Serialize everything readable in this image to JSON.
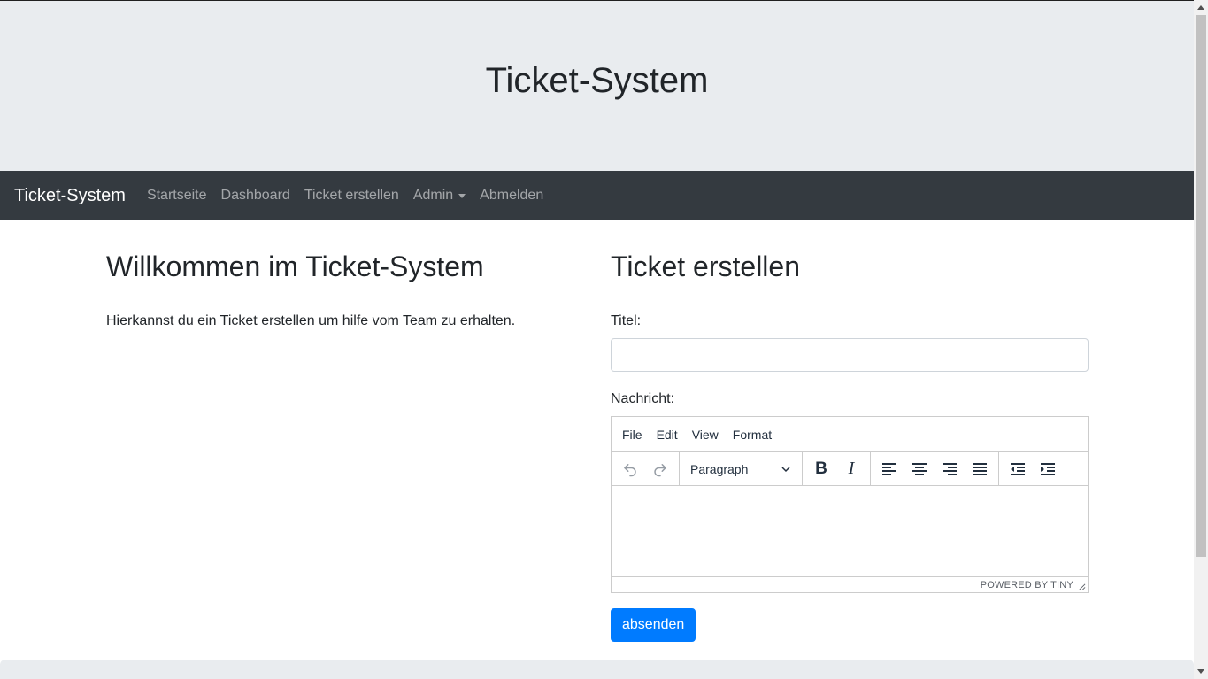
{
  "jumbotron": {
    "title": "Ticket-System"
  },
  "navbar": {
    "brand": "Ticket-System",
    "links": [
      "Startseite",
      "Dashboard",
      "Ticket erstellen",
      "Admin",
      "Abmelden"
    ]
  },
  "welcome": {
    "heading": "Willkommen im Ticket-System",
    "text": "Hierkannst du ein Ticket erstellen um hilfe vom Team zu erhalten."
  },
  "form": {
    "heading": "Ticket erstellen",
    "title_label": "Titel:",
    "title_value": "",
    "message_label": "Nachricht:",
    "editor": {
      "menu": [
        "File",
        "Edit",
        "View",
        "Format"
      ],
      "block_format": "Paragraph",
      "bold_glyph": "B",
      "italic_glyph": "I",
      "powered_by": "POWERED BY TINY"
    },
    "submit_label": "absenden"
  },
  "colors": {
    "jumbotron_bg": "#e9ecef",
    "navbar_bg": "#343a40",
    "primary": "#007bff"
  }
}
